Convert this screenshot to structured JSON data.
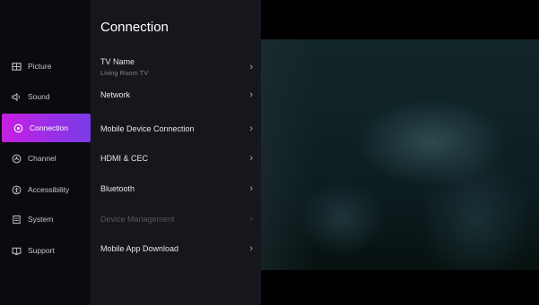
{
  "sidebar": {
    "items": [
      {
        "label": "Picture",
        "icon": "picture-icon",
        "active": false
      },
      {
        "label": "Sound",
        "icon": "sound-icon",
        "active": false
      },
      {
        "label": "Connection",
        "icon": "connection-icon",
        "active": true
      },
      {
        "label": "Channel",
        "icon": "channel-icon",
        "active": false
      },
      {
        "label": "Accessibility",
        "icon": "accessibility-icon",
        "active": false
      },
      {
        "label": "System",
        "icon": "system-icon",
        "active": false
      },
      {
        "label": "Support",
        "icon": "support-icon",
        "active": false
      }
    ],
    "accent_color": "#c71fe0"
  },
  "menu": {
    "title": "Connection",
    "items": [
      {
        "label": "TV Name",
        "value": "Living Room TV",
        "enabled": true
      },
      {
        "label": "Network",
        "enabled": true
      },
      {
        "label": "Mobile Device Connection",
        "enabled": true
      },
      {
        "label": "HDMI & CEC",
        "enabled": true
      },
      {
        "label": "Bluetooth",
        "enabled": true
      },
      {
        "label": "Device Management",
        "enabled": false
      },
      {
        "label": "Mobile App Download",
        "enabled": true
      }
    ],
    "chevron": "›"
  }
}
